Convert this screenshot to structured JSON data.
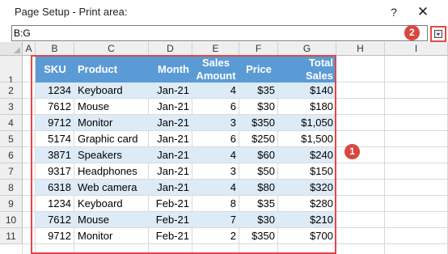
{
  "dialog": {
    "title": "Page Setup - Print area:",
    "help_label": "?",
    "close_label": "✕",
    "range_value": "B:G",
    "collapse_icon": "collapse-dialog-icon"
  },
  "annotations": {
    "badge_1": "1",
    "badge_2": "2"
  },
  "colors": {
    "header_fill": "#5b9bd5",
    "band_fill": "#ddebf7",
    "highlight_border": "#e04848",
    "badge_fill": "#d9473f"
  },
  "sheet": {
    "columns": [
      "A",
      "B",
      "C",
      "D",
      "E",
      "F",
      "G",
      "H",
      "I"
    ],
    "rows": [
      "1",
      "2",
      "3",
      "4",
      "5",
      "6",
      "7",
      "8",
      "9",
      "10",
      "11"
    ],
    "table": {
      "headers": {
        "sku": "SKU",
        "product": "Product",
        "month": "Month",
        "sales_amount_1": "Sales",
        "sales_amount_2": "Amount",
        "price": "Price",
        "total_sales_1": "Total",
        "total_sales_2": "Sales"
      },
      "rows": [
        {
          "sku": "1234",
          "product": "Keyboard",
          "month": "Jan-21",
          "amount": "4",
          "price": "$35",
          "total": "$140"
        },
        {
          "sku": "7612",
          "product": "Mouse",
          "month": "Jan-21",
          "amount": "6",
          "price": "$30",
          "total": "$180"
        },
        {
          "sku": "9712",
          "product": "Monitor",
          "month": "Jan-21",
          "amount": "3",
          "price": "$350",
          "total": "$1,050"
        },
        {
          "sku": "5174",
          "product": "Graphic card",
          "month": "Jan-21",
          "amount": "6",
          "price": "$250",
          "total": "$1,500"
        },
        {
          "sku": "3871",
          "product": "Speakers",
          "month": "Jan-21",
          "amount": "4",
          "price": "$60",
          "total": "$240"
        },
        {
          "sku": "9317",
          "product": "Headphones",
          "month": "Jan-21",
          "amount": "3",
          "price": "$50",
          "total": "$150"
        },
        {
          "sku": "6318",
          "product": "Web camera",
          "month": "Jan-21",
          "amount": "4",
          "price": "$80",
          "total": "$320"
        },
        {
          "sku": "1234",
          "product": "Keyboard",
          "month": "Feb-21",
          "amount": "8",
          "price": "$35",
          "total": "$280"
        },
        {
          "sku": "7612",
          "product": "Mouse",
          "month": "Feb-21",
          "amount": "7",
          "price": "$30",
          "total": "$210"
        },
        {
          "sku": "9712",
          "product": "Monitor",
          "month": "Feb-21",
          "amount": "2",
          "price": "$350",
          "total": "$700"
        }
      ]
    }
  }
}
